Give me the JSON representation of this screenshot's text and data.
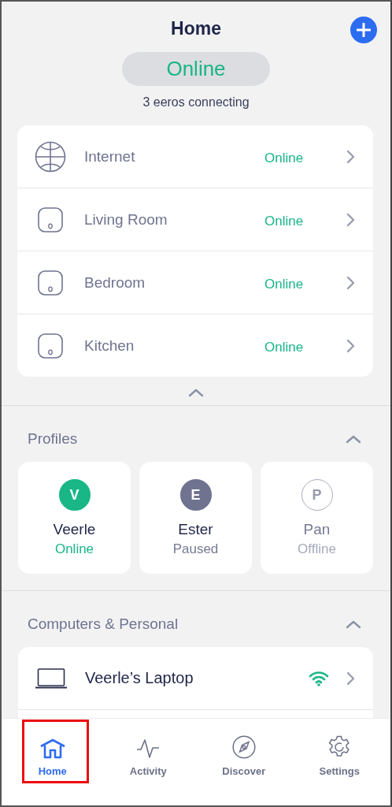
{
  "header": {
    "title": "Home",
    "network_status": "Online",
    "subtitle": "3 eeros connecting"
  },
  "network": [
    {
      "kind": "globe",
      "name": "Internet",
      "status": "Online",
      "online": true
    },
    {
      "kind": "eero",
      "name": "Living Room",
      "status": "Online",
      "online": true
    },
    {
      "kind": "eero",
      "name": "Bedroom",
      "status": "Online",
      "online": true
    },
    {
      "kind": "eero",
      "name": "Kitchen",
      "status": "Online",
      "online": true
    }
  ],
  "network_expanded": true,
  "profiles": {
    "title": "Profiles",
    "expanded": true,
    "items": [
      {
        "initial": "V",
        "name": "Veerle",
        "status": "Online",
        "kind": "online"
      },
      {
        "initial": "E",
        "name": "Ester",
        "status": "Paused",
        "kind": "paused"
      },
      {
        "initial": "P",
        "name": "Pan",
        "status": "Offline",
        "kind": "offline"
      }
    ]
  },
  "devices": {
    "title": "Computers & Personal",
    "expanded": true,
    "items": [
      {
        "kind": "laptop",
        "name": "Veerle’s Laptop",
        "wifi": true
      }
    ]
  },
  "tabs": [
    {
      "kind": "home",
      "label": "Home",
      "selected": true,
      "highlighted": true
    },
    {
      "kind": "activity",
      "label": "Activity",
      "selected": false,
      "highlighted": false
    },
    {
      "kind": "discover",
      "label": "Discover",
      "selected": false,
      "highlighted": false
    },
    {
      "kind": "settings",
      "label": "Settings",
      "selected": false,
      "highlighted": false
    }
  ]
}
